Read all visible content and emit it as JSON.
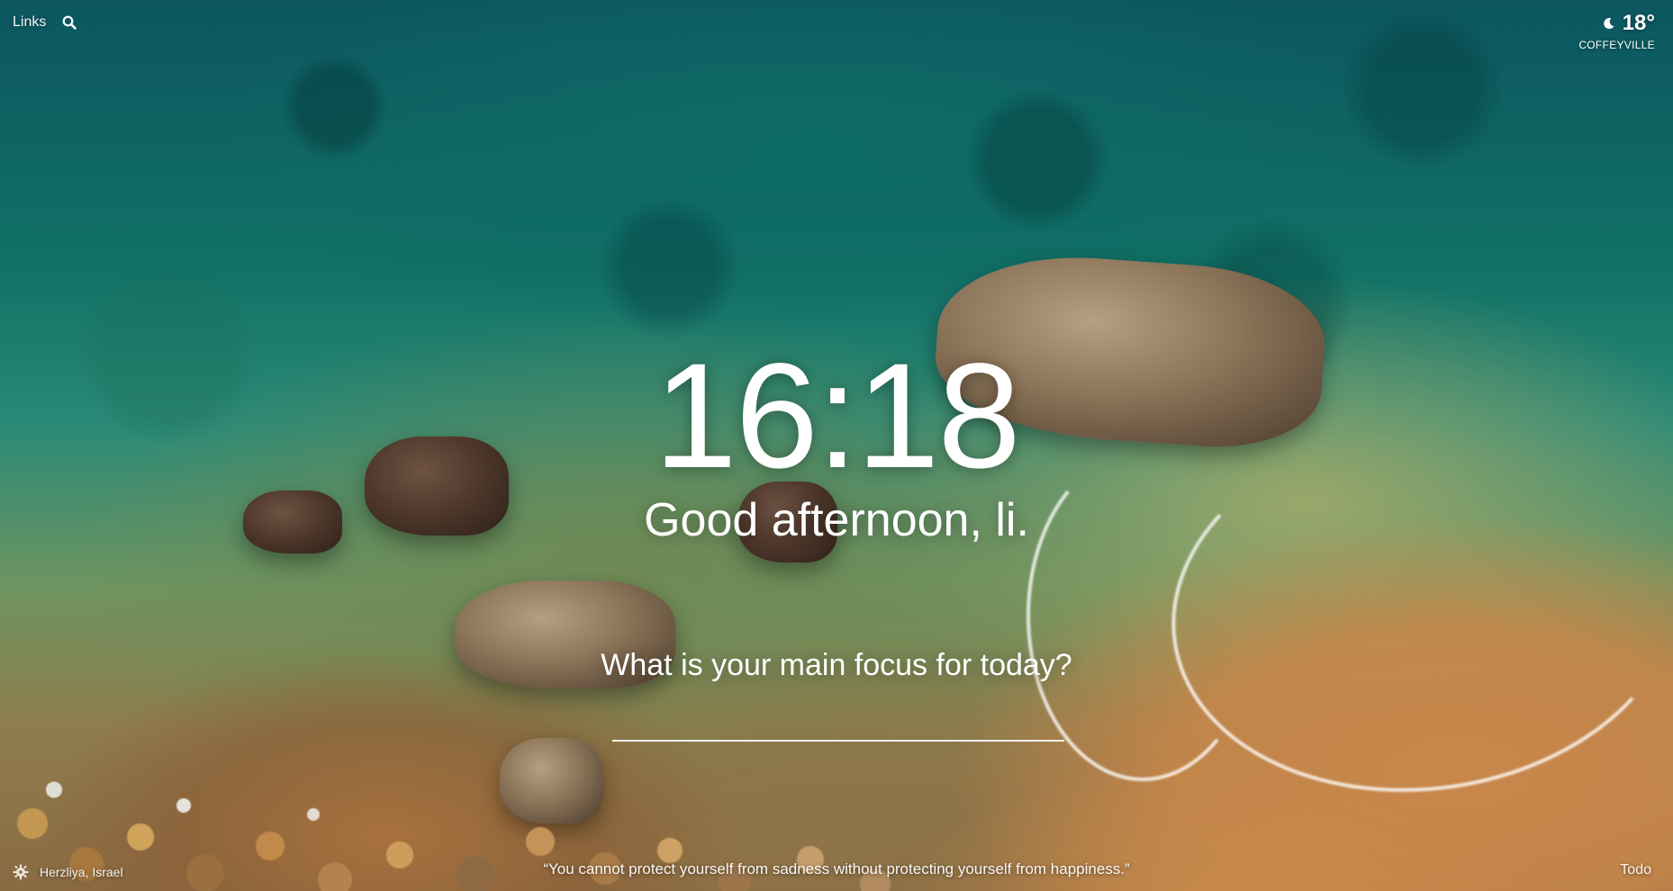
{
  "topbar": {
    "links_label": "Links",
    "search_icon": "search-icon"
  },
  "weather": {
    "icon": "moon-icon",
    "temperature": "18°",
    "location": "COFFEYVILLE"
  },
  "clock": {
    "time": "16:18"
  },
  "greeting": {
    "text": "Good afternoon, li."
  },
  "focus": {
    "question": "What is your main focus for today?",
    "input_value": ""
  },
  "footer": {
    "settings_icon": "settings-icon",
    "photo_location": "Herzliya, Israel",
    "quote": "“You cannot protect yourself from sadness without protecting yourself from happiness.”",
    "todo_label": "Todo"
  },
  "colors": {
    "text": "#ffffff",
    "sea": "#117165",
    "sand": "#c9874a"
  }
}
